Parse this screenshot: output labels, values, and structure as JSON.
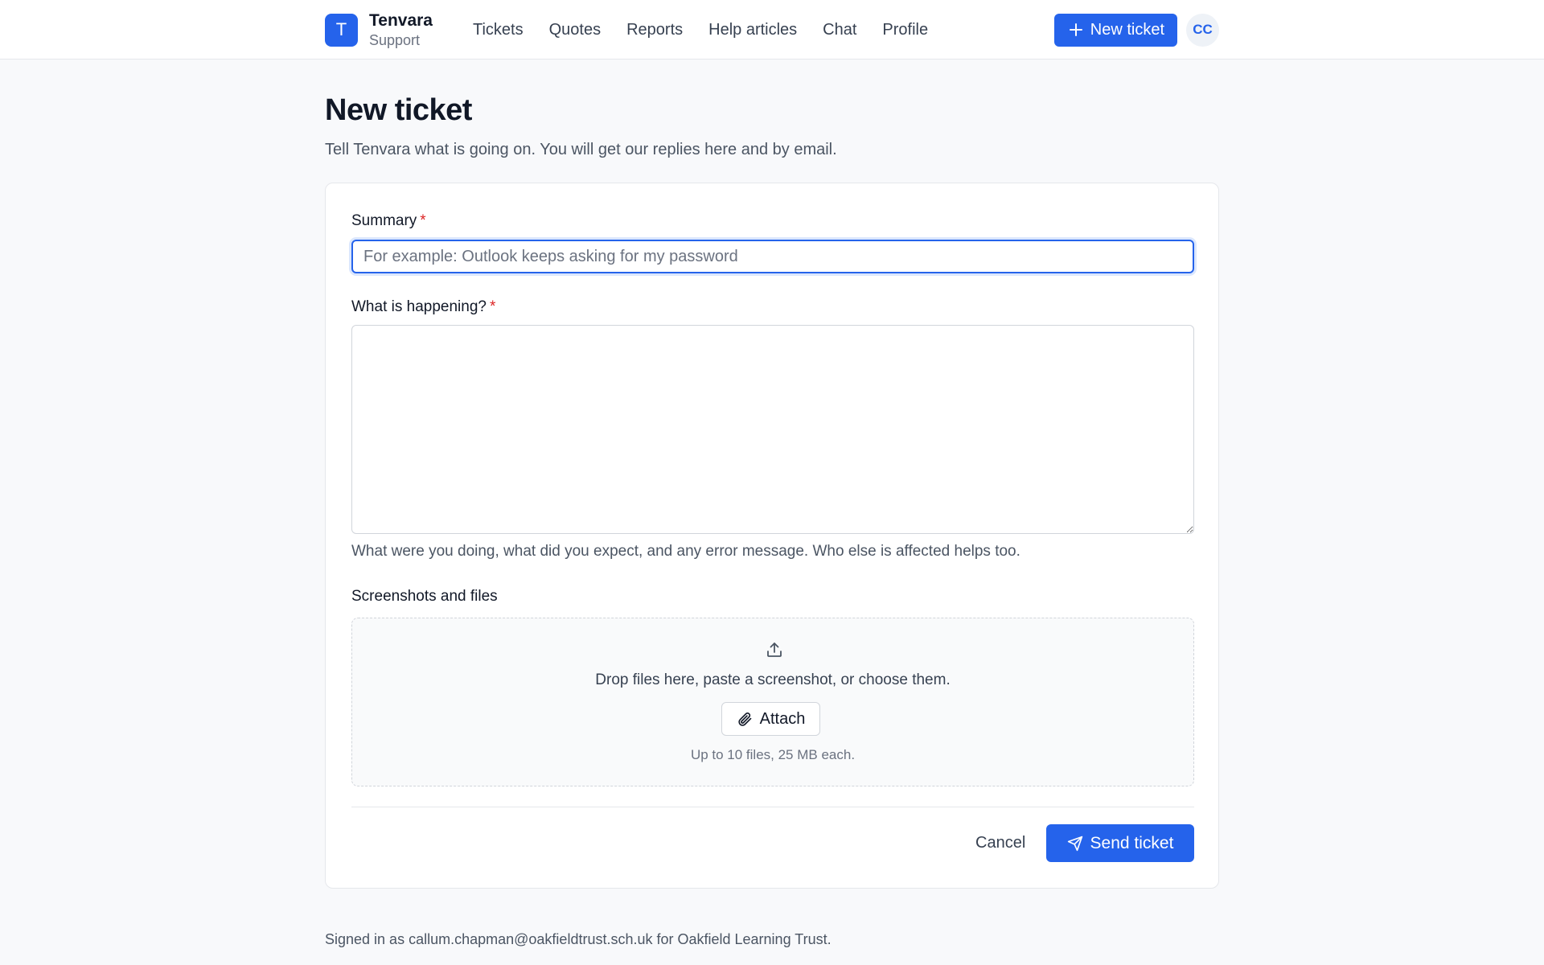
{
  "header": {
    "logo_letter": "T",
    "brand_name": "Tenvara",
    "brand_sub": "Support",
    "nav": [
      {
        "label": "Tickets"
      },
      {
        "label": "Quotes"
      },
      {
        "label": "Reports"
      },
      {
        "label": "Help articles"
      },
      {
        "label": "Chat"
      },
      {
        "label": "Profile"
      }
    ],
    "new_ticket_label": "New ticket",
    "avatar_initials": "CC",
    "icons": {
      "new_ticket": "plus-icon"
    }
  },
  "page": {
    "title": "New ticket",
    "subtitle": "Tell Tenvara what is going on. You will get our replies here and by email."
  },
  "form": {
    "summary_label": "Summary",
    "required_mark": "*",
    "summary_value": "",
    "summary_placeholder": "For example: Outlook keeps asking for my password",
    "description_label": "What is happening?",
    "description_value": "",
    "description_hint": "What were you doing, what did you expect, and any error message. Who else is affected helps too.",
    "files_label": "Screenshots and files",
    "dropzone_text": "Drop files here, paste a screenshot, or choose them.",
    "attach_label": "Attach",
    "dropzone_limit": "Up to 10 files, 25 MB each.",
    "cancel_label": "Cancel",
    "send_label": "Send ticket",
    "icons": {
      "upload": "upload-icon",
      "attach": "paperclip-icon",
      "send": "send-icon"
    }
  },
  "footer": {
    "signed_in_text": "Signed in as callum.chapman@oakfieldtrust.sch.uk for Oakfield Learning Trust."
  },
  "colors": {
    "accent": "#2563eb",
    "required": "#dc2626",
    "page_background": "#f8f9fb"
  }
}
